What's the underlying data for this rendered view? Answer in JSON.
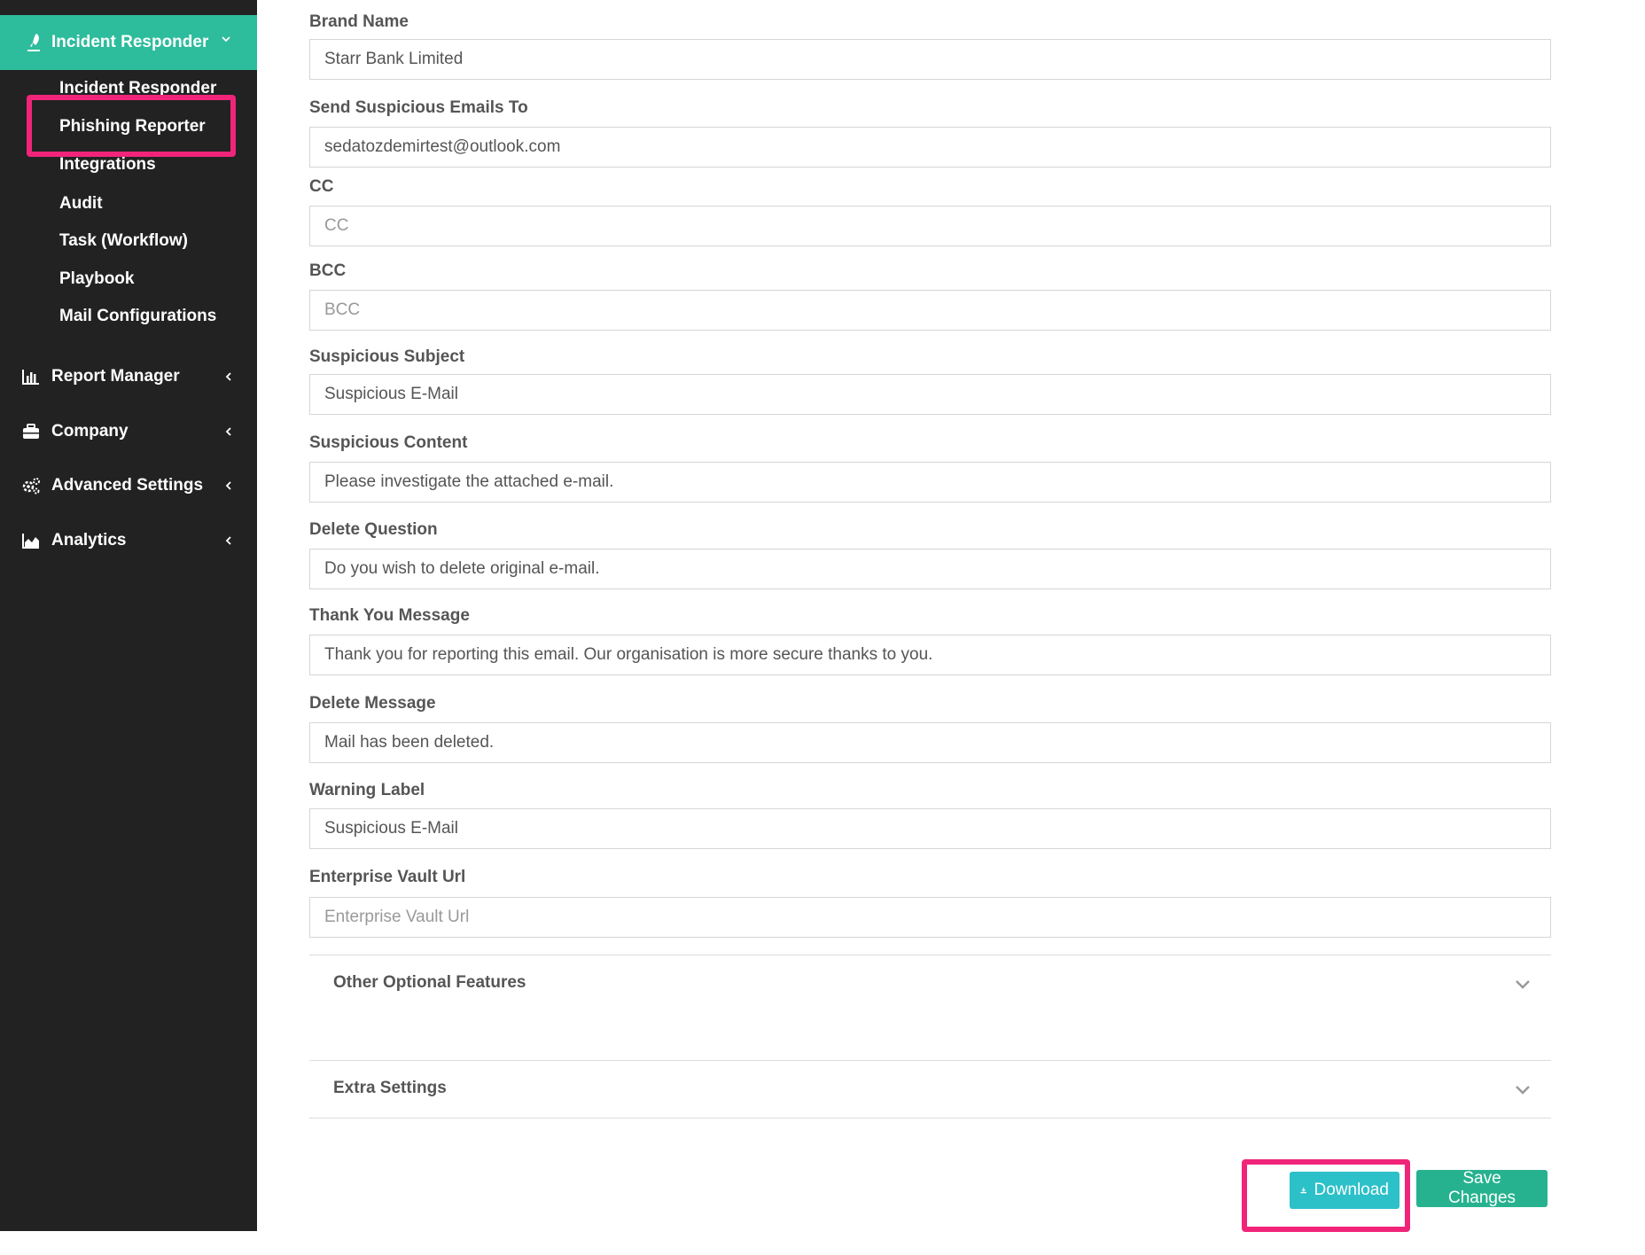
{
  "sidebar": {
    "active_section": {
      "label": "Incident Responder",
      "icon": "rocket-icon",
      "chevron": "chevron-down-icon"
    },
    "sub_items": [
      {
        "label": "Incident Responder"
      },
      {
        "label": "Phishing Reporter"
      },
      {
        "label": "Integrations"
      },
      {
        "label": "Audit"
      },
      {
        "label": "Task (Workflow)"
      },
      {
        "label": "Playbook"
      },
      {
        "label": "Mail Configurations"
      }
    ],
    "menu_items": [
      {
        "label": "Report Manager",
        "icon": "bar-chart-icon"
      },
      {
        "label": "Company",
        "icon": "briefcase-icon"
      },
      {
        "label": "Advanced Settings",
        "icon": "cogs-icon"
      },
      {
        "label": "Analytics",
        "icon": "area-chart-icon"
      }
    ],
    "colors": {
      "background": "#222222",
      "active": "#2dbc9c"
    }
  },
  "form": {
    "fields": [
      {
        "label": "Brand Name",
        "value": "Starr Bank Limited",
        "placeholder": ""
      },
      {
        "label": "Send Suspicious Emails To",
        "value": "sedatozdemirtest@outlook.com",
        "placeholder": ""
      },
      {
        "label": "CC",
        "value": "",
        "placeholder": "CC"
      },
      {
        "label": "BCC",
        "value": "",
        "placeholder": "BCC"
      },
      {
        "label": "Suspicious Subject",
        "value": "Suspicious E-Mail",
        "placeholder": ""
      },
      {
        "label": "Suspicious Content",
        "value": "Please investigate the attached e-mail.",
        "placeholder": ""
      },
      {
        "label": "Delete Question",
        "value": "Do you wish to delete original e-mail.",
        "placeholder": ""
      },
      {
        "label": "Thank You Message",
        "value": "Thank you for reporting this email. Our organisation is more secure thanks to you.",
        "placeholder": ""
      },
      {
        "label": "Delete Message",
        "value": "Mail has been deleted.",
        "placeholder": ""
      },
      {
        "label": "Warning Label",
        "value": "Suspicious E-Mail",
        "placeholder": ""
      },
      {
        "label": "Enterprise Vault Url",
        "value": "",
        "placeholder": "Enterprise Vault Url"
      }
    ],
    "accordions": [
      {
        "title": "Other Optional Features"
      },
      {
        "title": "Extra Settings"
      }
    ]
  },
  "actions": {
    "download_label": "Download",
    "download_icon": "download-icon",
    "save_label": "Save Changes",
    "colors": {
      "download": "#2cc0c8",
      "save": "#27b28f",
      "highlight": "#f0257a"
    }
  }
}
